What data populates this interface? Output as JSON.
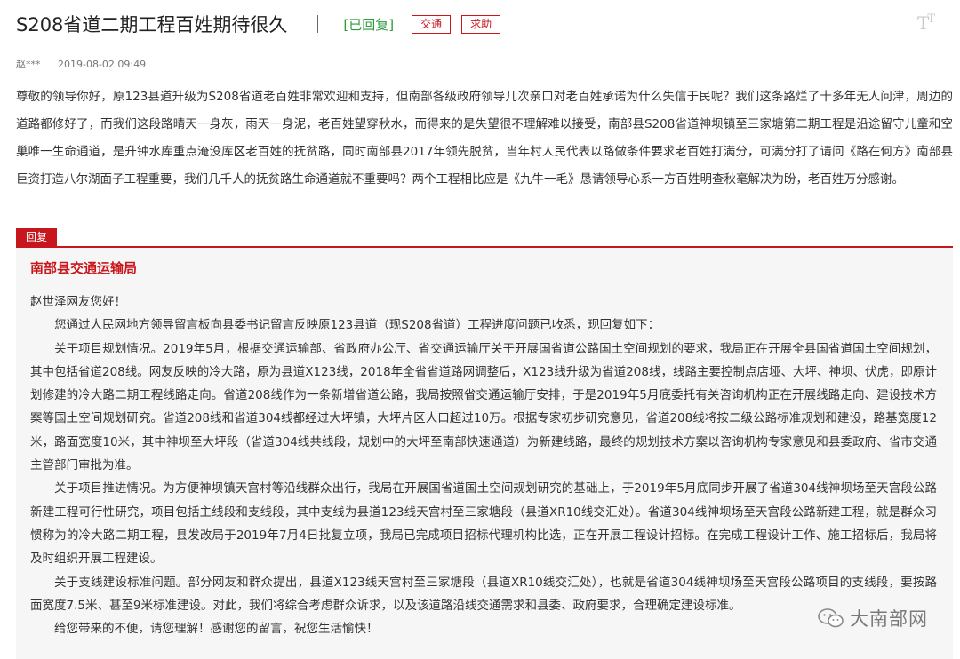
{
  "header": {
    "title": "S208省道二期工程百姓期待很久",
    "status": "[已回复]",
    "tags": [
      "交通",
      "求助"
    ],
    "font_toggle": "T"
  },
  "meta": {
    "author": "赵***",
    "date": "2019-08-02 09:49"
  },
  "question": {
    "text": "尊敬的领导你好，原123县道升级为S208省道老百姓非常欢迎和支持，但南部各级政府领导几次亲口对老百姓承诺为什么失信于民呢？我们这条路烂了十多年无人问津，周边的道路都修好了，而我们这段路晴天一身灰，雨天一身泥，老百姓望穿秋水，而得来的是失望很不理解难以接受，南部县S208省道神坝镇至三家塘第二期工程是沿途留守儿童和空巢唯一生命通道，是升钟水库重点淹没库区老百姓的抚贫路，同时南部县2017年领先脱贫，当年村人民代表以路做条件要求老百姓打满分，可满分打了请问《路在何方》南部县巨资打造八尔湖面子工程重要，我们几千人的抚贫路生命通道就不重要吗？两个工程相比应是《九牛一毛》恳请领导心系一方百姓明查秋毫解决为盼，老百姓万分感谢。"
  },
  "reply": {
    "tab_label": "回复",
    "organization": "南部县交通运输局",
    "paragraphs": [
      "赵世泽网友您好！",
      "您通过人民网地方领导留言板向县委书记留言反映原123县道（现S208省道）工程进度问题已收悉，现回复如下：",
      "关于项目规划情况。2019年5月，根据交通运输部、省政府办公厅、省交通运输厅关于开展国省道公路国土空间规划的要求，我局正在开展全县国省道国土空间规划，其中包括省道208线。网友反映的冷大路，原为县道X123线，2018年全省省道路网调整后，X123线升级为省道208线，线路主要控制点店垭、大坪、神坝、伏虎，即原计划修建的冷大路二期工程线路走向。省道208线作为一条新增省道公路，我局按照省交通运输厅安排，于是2019年5月底委托有关咨询机构正在开展线路走向、建设技术方案等国土空间规划研究。省道208线和省道304线都经过大坪镇，大坪片区人口超过10万。根据专家初步研究意见，省道208线将按二级公路标准规划和建设，路基宽度12米，路面宽度10米，其中神坝至大坪段（省道304线共线段，规划中的大坪至南部快速通道）为新建线路，最终的规划技术方案以咨询机构专家意见和县委政府、省市交通主管部门审批为准。",
      "关于项目推进情况。为方便神坝镇天宫村等沿线群众出行，我局在开展国省道国土空间规划研究的基础上，于2019年5月底同步开展了省道304线神坝场至天宫段公路新建工程可行性研究，项目包括主线段和支线段，其中支线为县道123线天宫村至三家塘段（县道XR10线交汇处）。省道304线神坝场至天宫段公路新建工程，就是群众习惯称为的冷大路二期工程，县发改局于2019年7月4日批复立项，我局已完成项目招标代理机构比选，正在开展工程设计招标。在完成工程设计工作、施工招标后，我局将及时组织开展工程建设。",
      "关于支线建设标准问题。部分网友和群众提出，县道X123线天宫村至三家塘段（县道XR10线交汇处），也就是省道304线神坝场至天宫段公路项目的支线段，要按路面宽度7.5米、甚至9米标准建设。对此，我们将综合考虑群众诉求，以及该道路沿线交通需求和县委、政府要求，合理确定建设标准。",
      "给您带来的不便，请您理解！感谢您的留言，祝您生活愉快！"
    ]
  },
  "watermark": {
    "icon": "wechat-icon",
    "text": "大南部网"
  },
  "colors": {
    "accent": "#c8161d",
    "status_green": "#2e9a3a",
    "reply_bg": "#f6f6f6"
  }
}
